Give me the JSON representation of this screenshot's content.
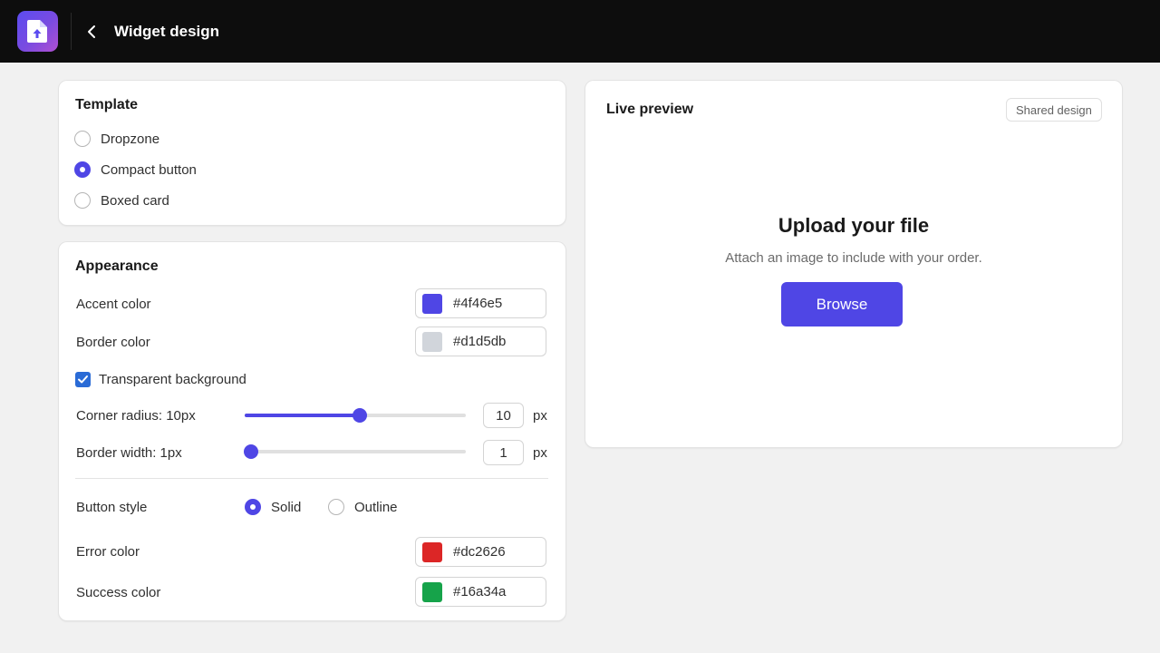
{
  "header": {
    "title": "Widget design",
    "icon": "file-upload-icon",
    "back_icon": "chevron-left-icon"
  },
  "template": {
    "title": "Template",
    "options": [
      {
        "label": "Dropzone",
        "checked": false
      },
      {
        "label": "Compact button",
        "checked": true
      },
      {
        "label": "Boxed card",
        "checked": false
      }
    ]
  },
  "appearance": {
    "title": "Appearance",
    "accent": {
      "label": "Accent color",
      "value": "#4f46e5"
    },
    "border": {
      "label": "Border color",
      "value": "#d1d5db"
    },
    "transparent_bg": {
      "label": "Transparent background",
      "checked": true
    },
    "corner_radius": {
      "label": "Corner radius:  10px",
      "value": "10",
      "unit": "px",
      "fraction": 0.52
    },
    "border_width": {
      "label": "Border width:  1px",
      "value": "1",
      "unit": "px",
      "fraction": 0.03
    },
    "button_style": {
      "label": "Button style",
      "options": [
        {
          "label": "Solid",
          "checked": true
        },
        {
          "label": "Outline",
          "checked": false
        }
      ]
    },
    "error": {
      "label": "Error color",
      "value": "#dc2626"
    },
    "success": {
      "label": "Success color",
      "value": "#16a34a"
    }
  },
  "preview": {
    "title": "Live preview",
    "badge": "Shared design",
    "upload_title": "Upload your file",
    "upload_subtitle": "Attach an image to include with your order.",
    "button_label": "Browse",
    "button_color": "#4f46e5"
  }
}
